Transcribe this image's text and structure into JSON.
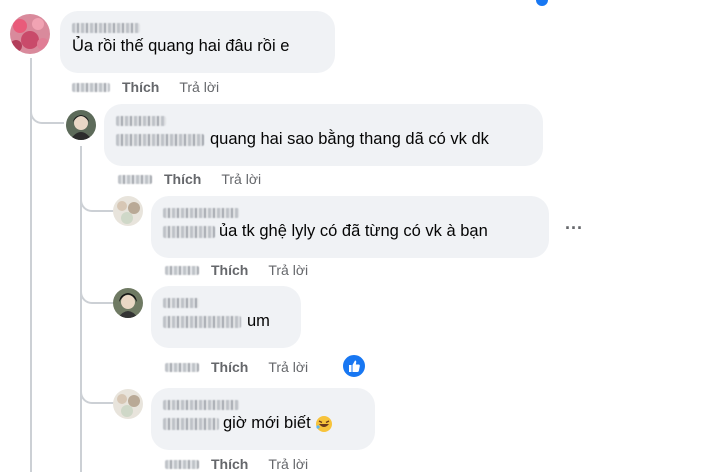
{
  "comments": [
    {
      "text": "Ủa rồi thế quang hai đâu rồi e"
    },
    {
      "text": "quang hai sao bằng thang dã có vk dk"
    },
    {
      "text": "ủa tk ghệ lyly có đã từng có vk à bạn"
    },
    {
      "text": "um"
    },
    {
      "text": "giờ mới biết"
    }
  ],
  "actions": {
    "like": "Thích",
    "reply": "Trả lời"
  },
  "more_label": "...",
  "icons": {
    "reaction": "like-thumb-icon",
    "emoji": "rolling-laughing-emoji-icon",
    "accent": "#1877f2"
  }
}
